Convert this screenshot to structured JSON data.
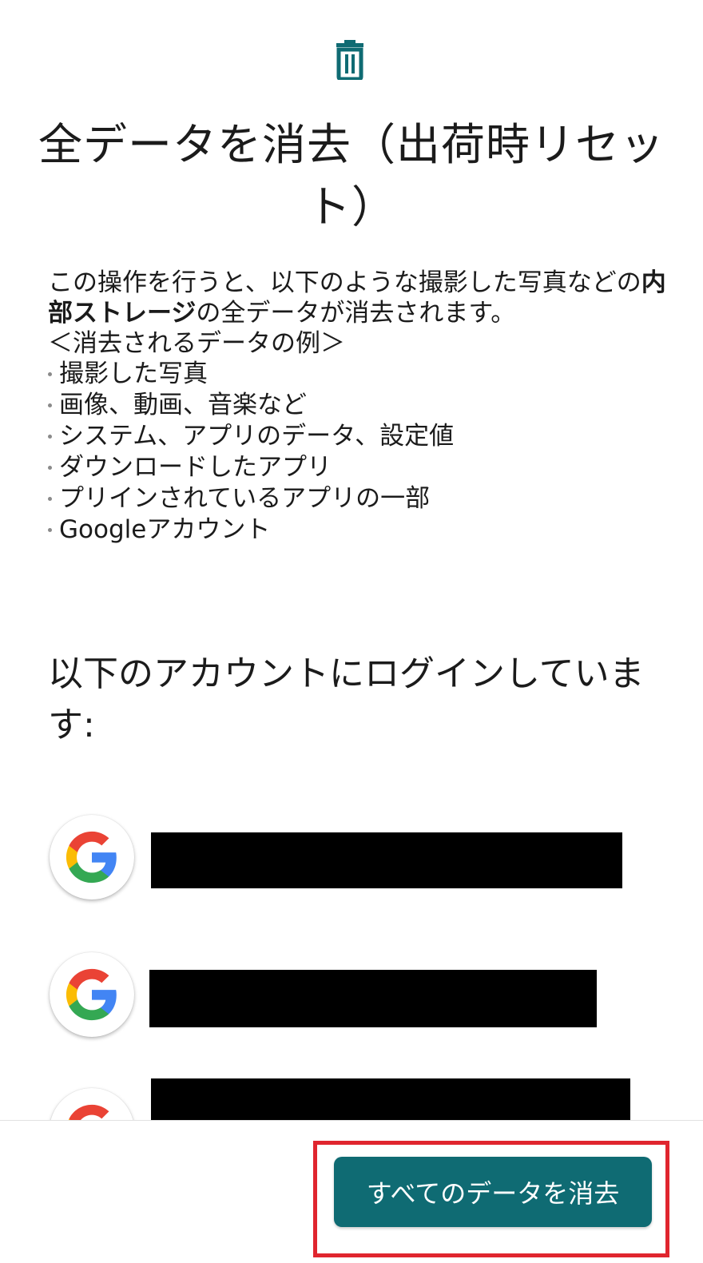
{
  "header": {
    "icon": "trash-icon",
    "title": "全データを消去（出荷時リセット）"
  },
  "description": {
    "intro_prefix": "この操作を行うと、以下のような撮影した写真などの",
    "intro_bold": "内部ストレージ",
    "intro_suffix": "の全データが消去されます。",
    "examples_heading": "＜消去されるデータの例＞",
    "examples": [
      "撮影した写真",
      "画像、動画、音楽など",
      "システム、アプリのデータ、設定値",
      "ダウンロードしたアプリ",
      "プリインされているアプリの一部",
      "Googleアカウント"
    ]
  },
  "accounts": {
    "heading": "以下のアカウントにログインしています:",
    "items": [
      {
        "icon": "google-icon"
      },
      {
        "icon": "google-icon"
      },
      {
        "icon": "google-icon"
      }
    ]
  },
  "footer": {
    "erase_button_label": "すべてのデータを消去"
  },
  "colors": {
    "accent": "#0f6b73",
    "highlight_border": "#e0252e",
    "text": "#1b1b1b"
  }
}
